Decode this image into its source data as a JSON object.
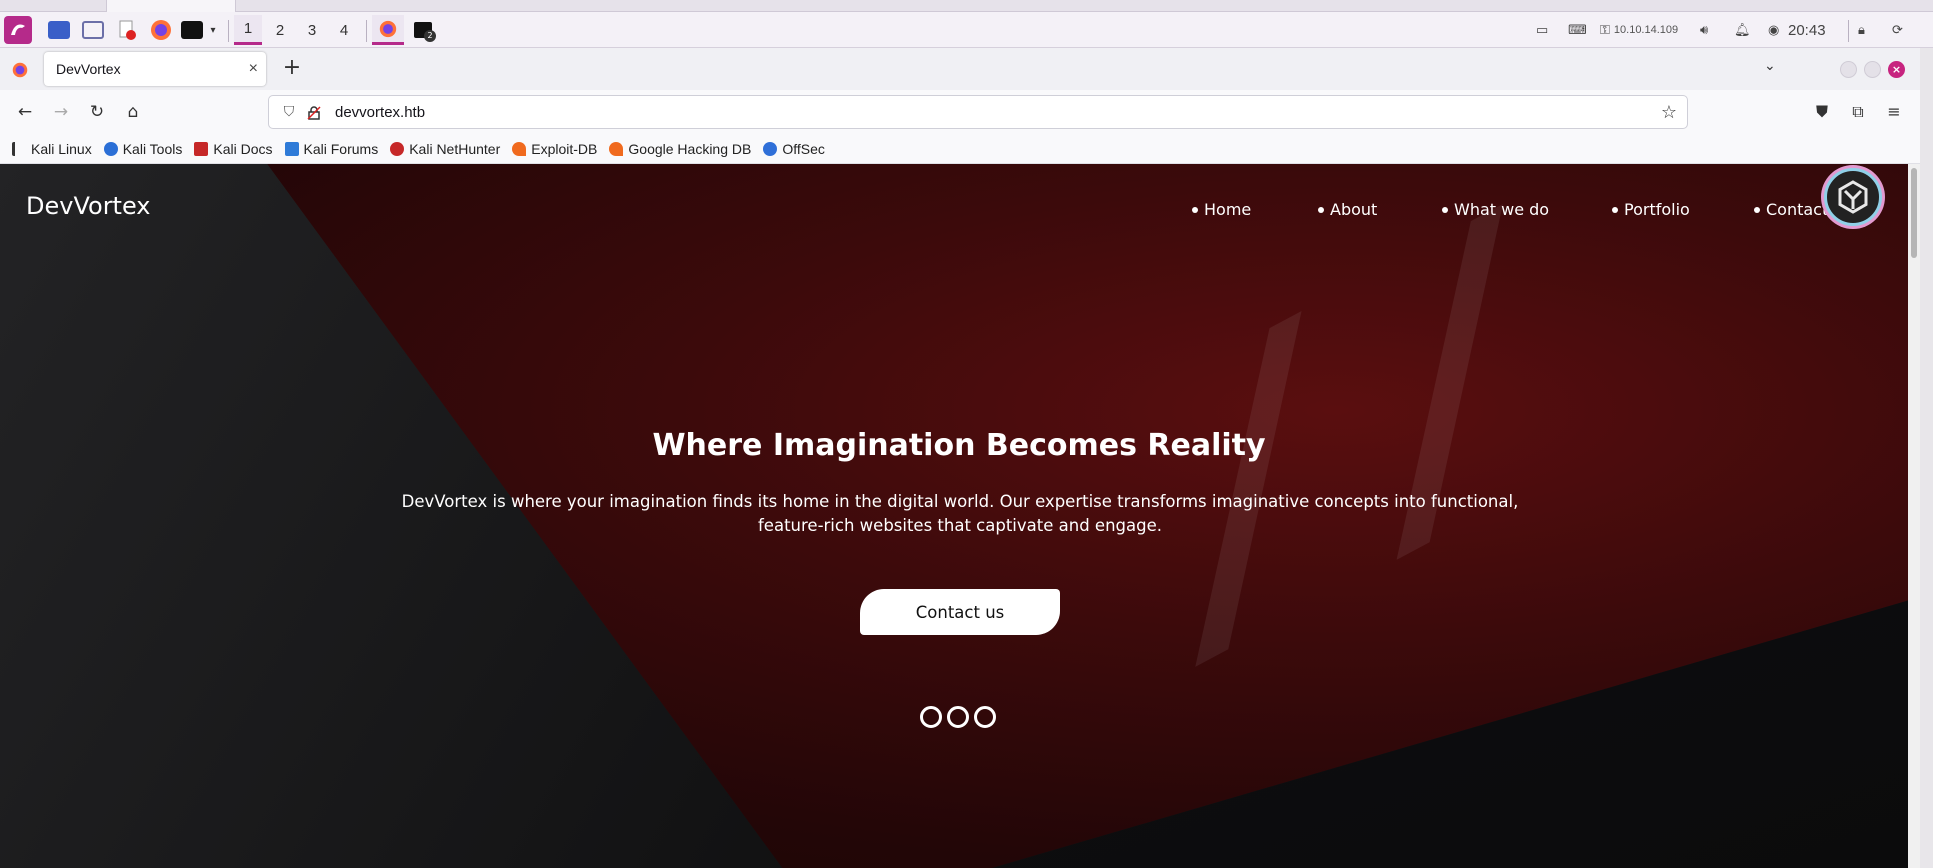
{
  "panel": {
    "workspaces": [
      "1",
      "2",
      "3",
      "4"
    ],
    "active_workspace": "1",
    "terminal_badge": "2",
    "ip": "10.10.14.109",
    "clock": "20:43"
  },
  "browser": {
    "tab_title": "DevVortex",
    "new_tab": "+",
    "tab_close": "×",
    "url": "devvortex.htb",
    "bookmarks": [
      "Kali Linux",
      "Kali Tools",
      "Kali Docs",
      "Kali Forums",
      "Kali NetHunter",
      "Exploit-DB",
      "Google Hacking DB",
      "OffSec"
    ]
  },
  "site": {
    "logo": "DevVortex",
    "nav": [
      "Home",
      "About",
      "What we do",
      "Portfolio",
      "Contact us"
    ],
    "hero_title": "Where Imagination Becomes Reality",
    "hero_text": "DevVortex is where your imagination finds its home in the digital world. Our expertise transforms imaginative concepts into functional, feature-rich websites that captivate and engage.",
    "cta": "Contact us"
  },
  "colors": {
    "kali_accent": "#b52a8a",
    "hero_red": "#5a0e0f",
    "close_button": "#c7247f"
  }
}
